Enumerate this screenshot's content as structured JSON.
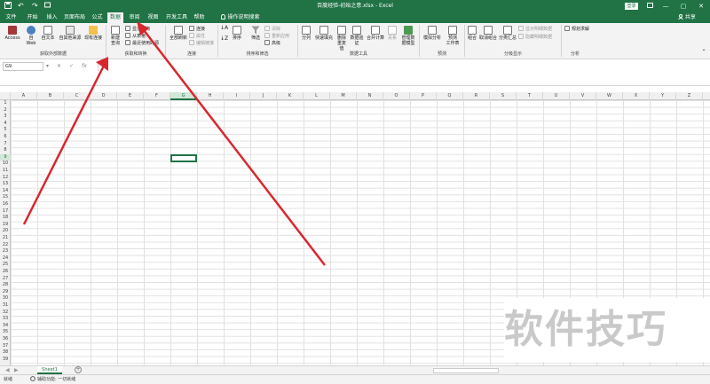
{
  "titlebar": {
    "save_icon": "save-icon",
    "undo_glyph": "↶",
    "redo_glyph": "↷",
    "title": "百度经验-初始之意.xlsx  -  Excel",
    "login_label": "登录",
    "minimize": "—",
    "restore": "▢",
    "close": "✕"
  },
  "tabs": [
    {
      "label": "文件"
    },
    {
      "label": "开始"
    },
    {
      "label": "插入"
    },
    {
      "label": "页面布局"
    },
    {
      "label": "公式"
    },
    {
      "label": "数据"
    },
    {
      "label": "审阅"
    },
    {
      "label": "视图"
    },
    {
      "label": "开发工具"
    },
    {
      "label": "帮助"
    },
    {
      "label": "操作说明搜索"
    }
  ],
  "share_label": "共享",
  "ribbon": {
    "get_external": {
      "access": "Access",
      "web_a": "自",
      "web_b": "Web",
      "text": "自文本",
      "other_a": "自其他来源",
      "existing": "现有连接",
      "group_label": "获取外部数据"
    },
    "get_transform": {
      "new_query_a": "新建",
      "new_query_b": "查询",
      "show_queries": "显示查询",
      "from_table": "从表格",
      "recent_sources": "最近使用的源",
      "group_label": "获取和转换"
    },
    "connections": {
      "refresh_all": "全部刷新",
      "conn": "连接",
      "props": "属性",
      "edit_links": "编辑链接",
      "group_label": "连接"
    },
    "sort_filter": {
      "sort": "排序",
      "filter": "筛选",
      "clear": "清除",
      "reapply": "重新应用",
      "advanced": "高级",
      "group_label": "排序和筛选"
    },
    "data_tools": {
      "split": "分列",
      "flash_fill": "快速填充",
      "dedupe_a": "删除",
      "dedupe_b": "重复值",
      "validate_a": "数据验",
      "validate_b": "证",
      "consolidate": "合并计算",
      "relations": "关系",
      "model_a": "管理数",
      "model_b": "据模型",
      "group_label": "数据工具"
    },
    "forecast": {
      "whatif": "模拟分析",
      "sheet_a": "预测",
      "sheet_b": "工作表",
      "group_label": "预测"
    },
    "outline": {
      "group": "组合",
      "ungroup": "取消组合",
      "subtotal": "分类汇总",
      "show_detail": "显示明细数据",
      "hide_detail": "隐藏明细数据",
      "group_label": "分级显示"
    },
    "analysis": {
      "solver": "规划求解",
      "group_label": "分析"
    }
  },
  "formula_bar": {
    "name_box": "G9",
    "cancel": "✕",
    "enter": "✓",
    "fx": "fx",
    "value": ""
  },
  "grid": {
    "columns": [
      "A",
      "B",
      "C",
      "D",
      "E",
      "F",
      "G",
      "H",
      "I",
      "J",
      "K",
      "L",
      "M",
      "N",
      "O",
      "P",
      "Q",
      "R",
      "S",
      "T",
      "U",
      "V",
      "W",
      "X",
      "Y",
      "Z"
    ],
    "selected_column": "G",
    "selected_row": 9,
    "rows": [
      1,
      2,
      3,
      4,
      5,
      6,
      7,
      8,
      9,
      10,
      11,
      12,
      13,
      14,
      15,
      16,
      17,
      18,
      19,
      20,
      21,
      22,
      23,
      24,
      25,
      26,
      27,
      28,
      29,
      30,
      31,
      32,
      33,
      34,
      35,
      36,
      37,
      38,
      39
    ]
  },
  "sheets": {
    "active": "Sheet1",
    "add_label": "+"
  },
  "status": {
    "ready": "就绪",
    "accessibility": "辅助功能: 一切就绪"
  },
  "watermark": "软件技巧",
  "colors": {
    "brand": "#217346",
    "arrow": "#d9272e"
  }
}
